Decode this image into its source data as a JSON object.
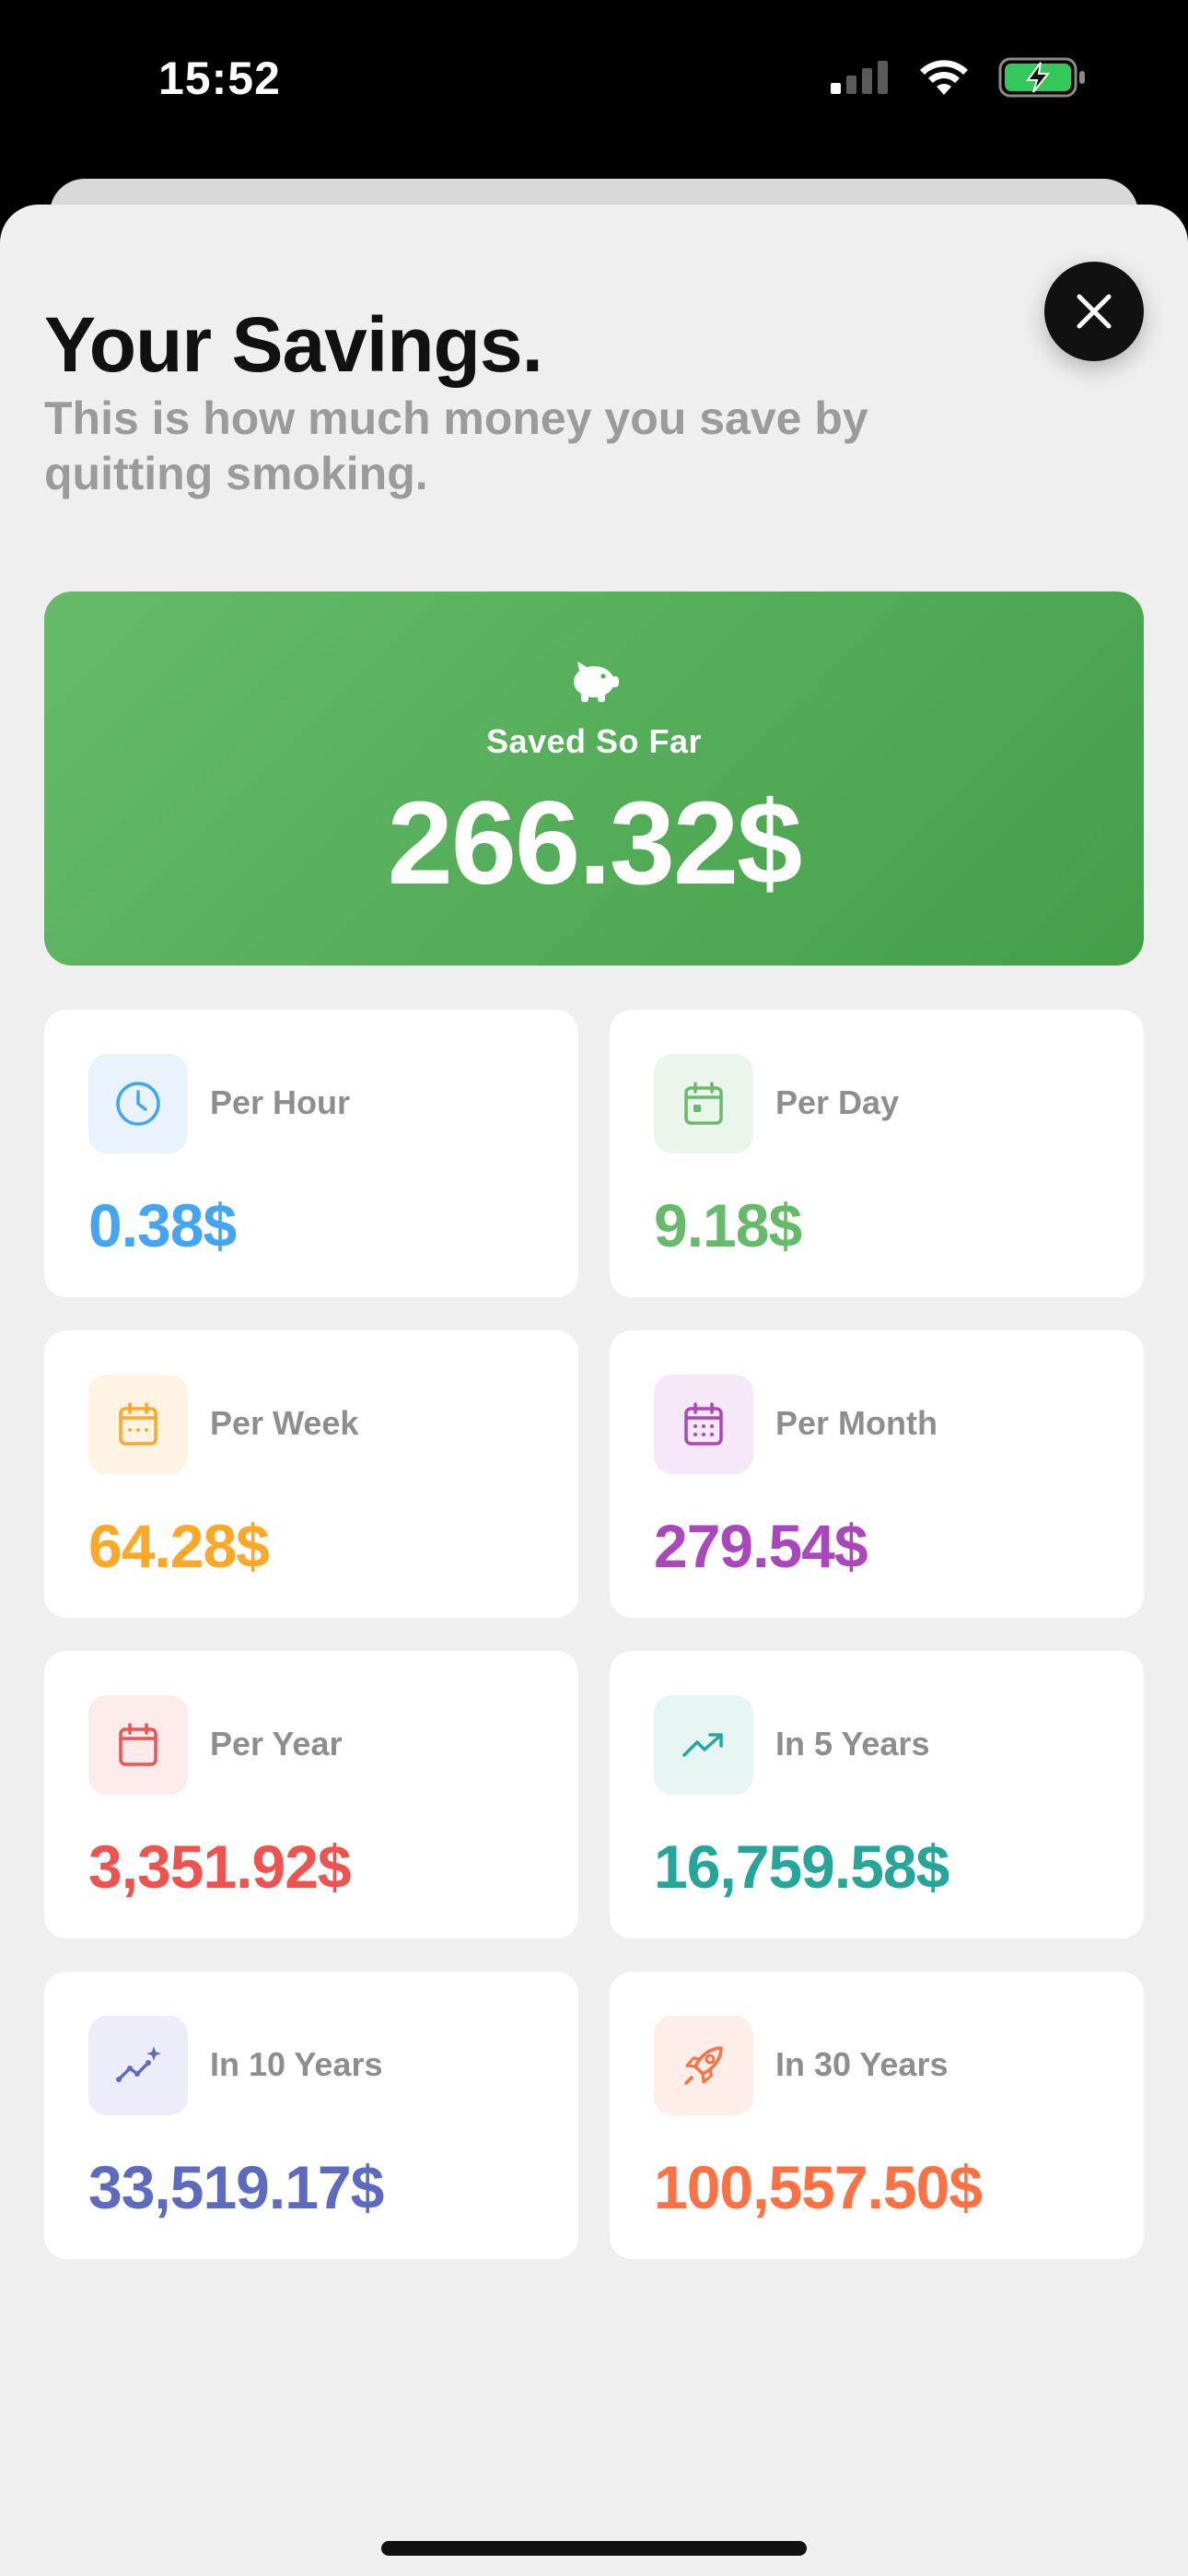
{
  "status": {
    "time": "15:52"
  },
  "header": {
    "title": "Your Savings.",
    "subtitle": "This is how much money you save by quitting smoking."
  },
  "hero": {
    "icon": "piggy-bank-icon",
    "label": "Saved So Far",
    "value": "266.32$",
    "color_start": "#66bb6a",
    "color_end": "#43a047"
  },
  "stats": [
    {
      "label": "Per Hour",
      "value": "0.38$",
      "icon": "clock-icon",
      "color": "#42a5f5",
      "bg": "#e8f3fd"
    },
    {
      "label": "Per Day",
      "value": "9.18$",
      "icon": "calendar-day-icon",
      "color": "#66bb6a",
      "bg": "#eaf6eb"
    },
    {
      "label": "Per Week",
      "value": "64.28$",
      "icon": "calendar-week-icon",
      "color": "#ffa726",
      "bg": "#fff3e4"
    },
    {
      "label": "Per Month",
      "value": "279.54$",
      "icon": "calendar-month-icon",
      "color": "#ab47bc",
      "bg": "#f5e9f7"
    },
    {
      "label": "Per Year",
      "value": "3,351.92$",
      "icon": "calendar-year-icon",
      "color": "#ef5350",
      "bg": "#fdeaea"
    },
    {
      "label": "In 5 Years",
      "value": "16,759.58$",
      "icon": "trend-up-icon",
      "color": "#26a69a",
      "bg": "#e6f5f3"
    },
    {
      "label": "In 10 Years",
      "value": "33,519.17$",
      "icon": "sparkle-chart-icon",
      "color": "#5c6bc0",
      "bg": "#ecedf8"
    },
    {
      "label": "In 30 Years",
      "value": "100,557.50$",
      "icon": "rocket-icon",
      "color": "#ff7043",
      "bg": "#ffede7"
    }
  ]
}
